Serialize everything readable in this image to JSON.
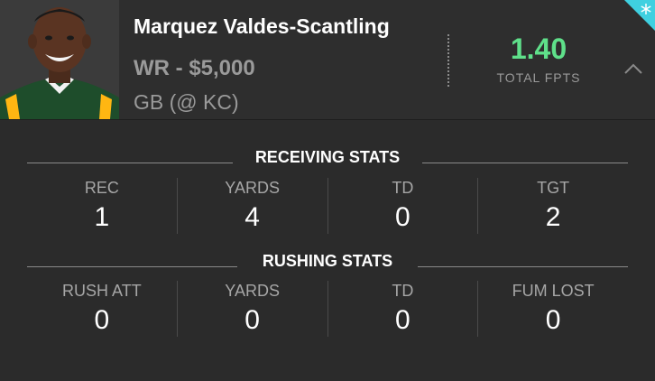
{
  "player": {
    "name": "Marquez Valdes-Scantling",
    "position_salary": "WR - $5,000",
    "matchup": "GB (@ KC)",
    "fpts_value": "1.40",
    "fpts_label": "TOTAL FPTS"
  },
  "icons": {
    "collapse": "chevron-up-icon",
    "corner_badge": "snowflake-icon",
    "avatar": "player-headshot"
  },
  "colors": {
    "fpts": "#5fe08a",
    "corner_badge": "#3fd0e0",
    "jersey": "#1e4d2b",
    "jersey_stripe": "#ffb612"
  },
  "receiving": {
    "title": "RECEIVING STATS",
    "stats": [
      {
        "label": "REC",
        "value": "1"
      },
      {
        "label": "YARDS",
        "value": "4"
      },
      {
        "label": "TD",
        "value": "0"
      },
      {
        "label": "TGT",
        "value": "2"
      }
    ]
  },
  "rushing": {
    "title": "RUSHING STATS",
    "stats": [
      {
        "label": "RUSH ATT",
        "value": "0"
      },
      {
        "label": "YARDS",
        "value": "0"
      },
      {
        "label": "TD",
        "value": "0"
      },
      {
        "label": "FUM LOST",
        "value": "0"
      }
    ]
  }
}
